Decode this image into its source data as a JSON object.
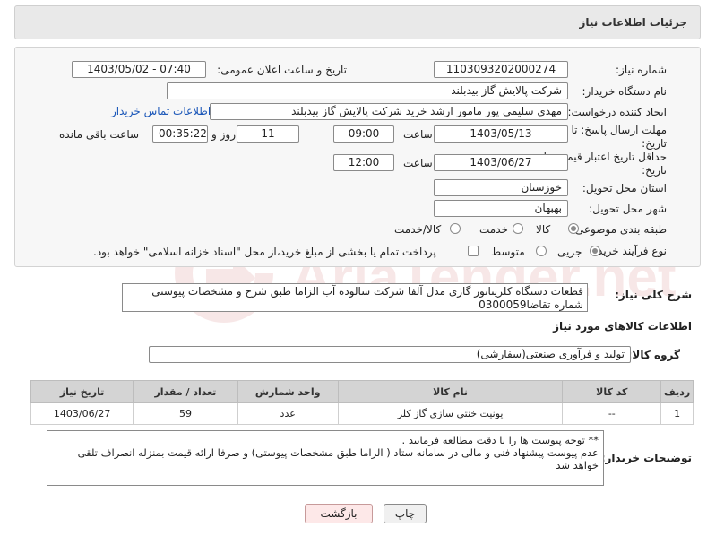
{
  "header": {
    "title": "جزئیات اطلاعات نیاز"
  },
  "fields": {
    "need_number_label": "شماره نیاز:",
    "need_number": "1103093202000274",
    "announce_label": "تاریخ و ساعت اعلان عمومی:",
    "announce_value": "1403/05/02 - 07:40",
    "buyer_org_label": "نام دستگاه خریدار:",
    "buyer_org": "شرکت پالایش گاز بیدبلند",
    "requester_label": "ایجاد کننده درخواست:",
    "requester": "مهدی سلیمی پور مامور ارشد خرید شرکت پالایش گاز بیدبلند",
    "contact_link": "اطلاعات تماس خریدار",
    "reply_deadline_label": "مهلت ارسال پاسخ: تا تاریخ:",
    "reply_date": "1403/05/13",
    "time_label": "ساعت",
    "reply_time": "09:00",
    "days_count": "11",
    "days_and_label": "روز و",
    "remaining_time": "00:35:22",
    "remaining_label": "ساعت باقی مانده",
    "price_validity_label": "حداقل تاریخ اعتبار قیمت: تا تاریخ:",
    "price_validity_date": "1403/06/27",
    "price_validity_time": "12:00",
    "province_label": "استان محل تحویل:",
    "province": "خوزستان",
    "city_label": "شهر محل تحویل:",
    "city": "بهبهان",
    "category_label": "طبقه بندی موضوعی:",
    "category_options": [
      "کالا",
      "خدمت",
      "کالا/خدمت"
    ],
    "process_label": "نوع فرآیند خرید :",
    "process_options": [
      "جزیی",
      "متوسط"
    ],
    "payment_note": "پرداخت تمام یا بخشی از مبلغ خرید،از محل \"اسناد خزانه اسلامی\" خواهد بود."
  },
  "description": {
    "label": "شرح کلی نیاز:",
    "text": "قطعات دستگاه کلریناتور گازی مدل آلفا شرکت سالوده آب الزاما طبق شرح و مشخصات پیوستی شماره تقاضا0300059"
  },
  "goods_info_title": "اطلاعات کالاهای مورد نیاز",
  "goods_group": {
    "label": "گروه کالا:",
    "value": "تولید و فرآوری صنعتی(سفارشی)"
  },
  "table": {
    "headers": [
      "ردیف",
      "کد کالا",
      "نام کالا",
      "واحد شمارش",
      "تعداد / مقدار",
      "تاریخ نیاز"
    ],
    "rows": [
      [
        "1",
        "--",
        "یونیت خنثی سازی گاز کلر",
        "عدد",
        "59",
        "1403/06/27"
      ]
    ]
  },
  "buyer_notes": {
    "label": "توضیحات خریدار:",
    "line1": "** توجه پیوست ها  را با دقت مطالعه فرمایید .",
    "line2": "عدم پیوست پیشنهاد فنی و مالی در سامانه ستاد ( الزاما طبق مشخصات پیوستی)  و صرفا ارائه قیمت بمنزله انصراف تلقی خواهد شد"
  },
  "buttons": {
    "print": "چاپ",
    "back": "بازگشت"
  },
  "watermark": {
    "text": "AriaTender.net"
  },
  "colors": {
    "link": "#1a56b8",
    "back_button_bg": "#fde8e8",
    "header_bg": "#e9e9e9"
  }
}
